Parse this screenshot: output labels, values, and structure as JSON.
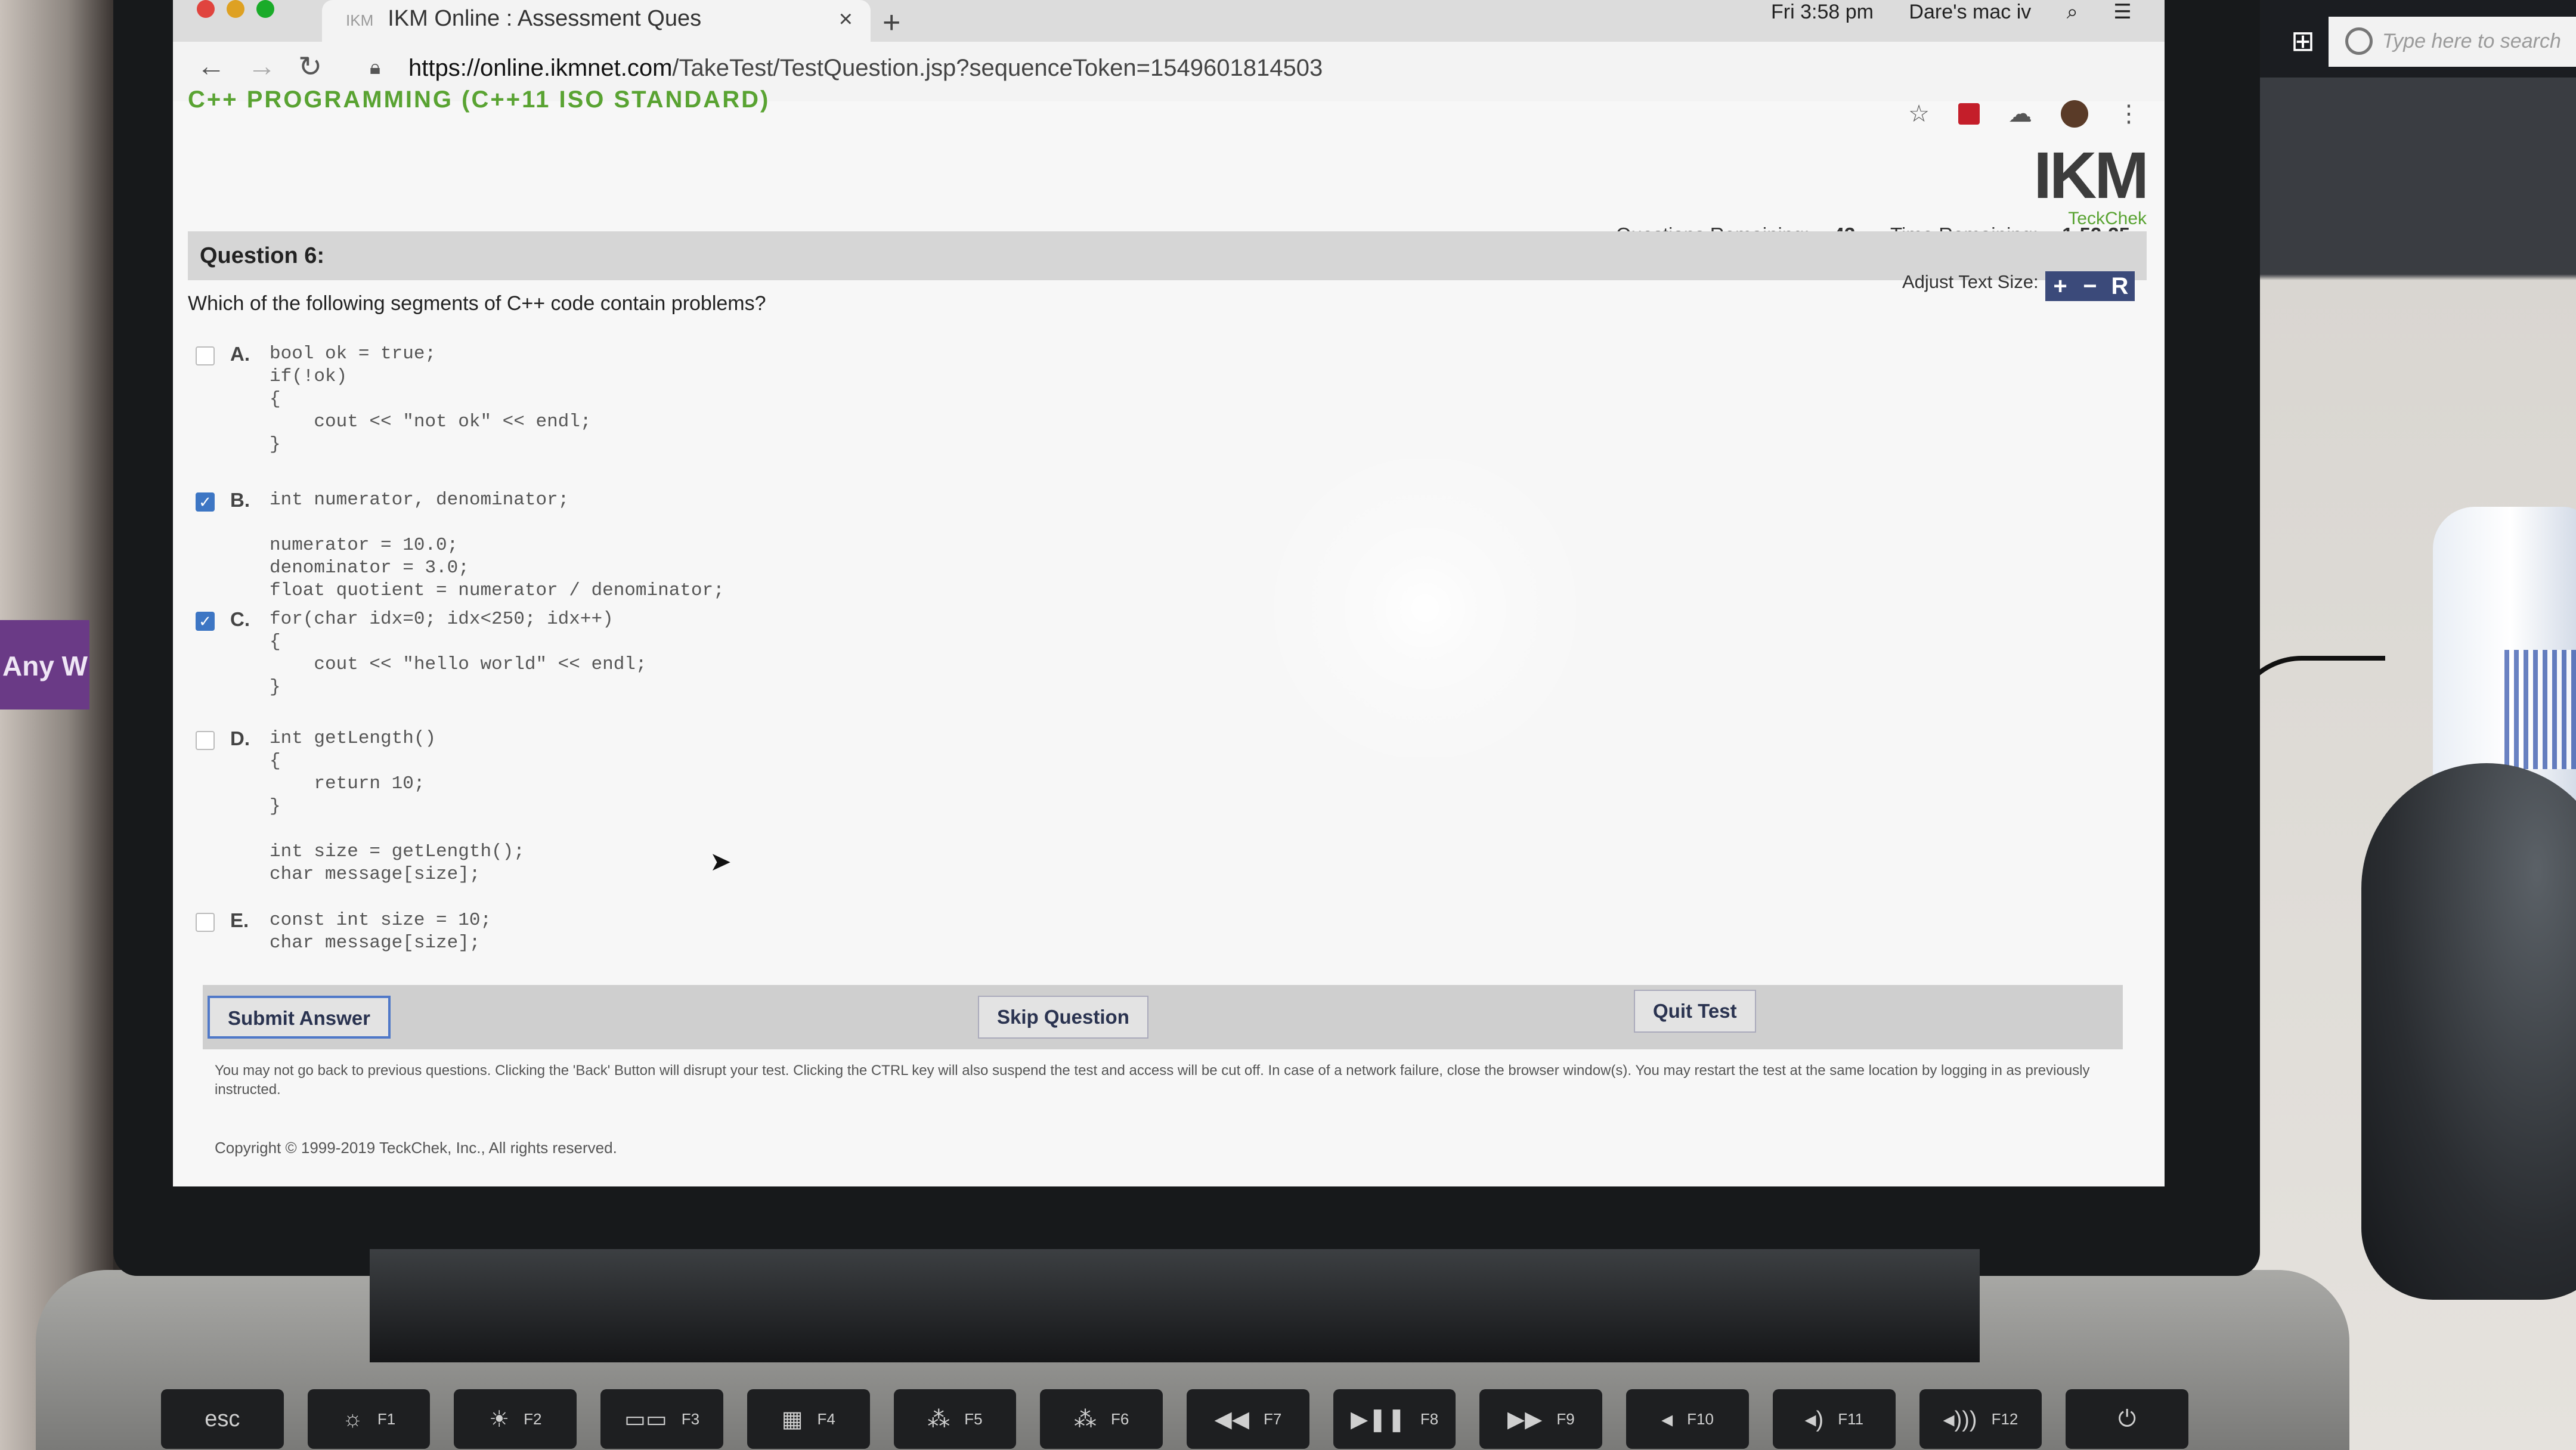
{
  "browser": {
    "tab_title": "IKM Online : Assessment Ques",
    "url_prefix": "https://online.ikmnet.com",
    "url_rest": "/TakeTest/TestQuestion.jsp?sequenceToken=1549601814503",
    "clock": "Fri 3:58 pm",
    "user": "Dare's mac iv"
  },
  "windows": {
    "search_placeholder": "Type here to search"
  },
  "desk": {
    "sticker_text": "Any W"
  },
  "page": {
    "course_title": "C++ PROGRAMMING (C++11 ISO STANDARD)",
    "logo_text": "IKM",
    "logo_subtitle": "TeckChek",
    "question_title": "Question 6:",
    "questions_remaining_label": "Questions Remaining:",
    "questions_remaining": "43",
    "time_remaining_label": "Time Remaining:",
    "time_remaining": "1:52:35",
    "adjust_text_label": "Adjust Text Size:",
    "adjust_plus": "+",
    "adjust_minus": "−",
    "adjust_reset": "R",
    "question_text": "Which of the following segments of C++ code contain problems?",
    "options": [
      {
        "letter": "A.",
        "checked": false,
        "code": "bool ok = true;\nif(!ok)\n{\n    cout << \"not ok\" << endl;\n}"
      },
      {
        "letter": "B.",
        "checked": true,
        "code": "int numerator, denominator;\n\nnumerator = 10.0;\ndenominator = 3.0;\nfloat quotient = numerator / denominator;"
      },
      {
        "letter": "C.",
        "checked": true,
        "code": "for(char idx=0; idx<250; idx++)\n{\n    cout << \"hello world\" << endl;\n}"
      },
      {
        "letter": "D.",
        "checked": false,
        "code": "int getLength()\n{\n    return 10;\n}\n\nint size = getLength();\nchar message[size];"
      },
      {
        "letter": "E.",
        "checked": false,
        "code": "const int size = 10;\nchar message[size];"
      }
    ],
    "submit_label": "Submit Answer",
    "skip_label": "Skip Question",
    "quit_label": "Quit Test",
    "notice": "You may not go back to previous questions. Clicking the 'Back' Button will disrupt your test. Clicking the CTRL key will also suspend the test and access will be cut off. In case of a network failure, close the browser window(s). You may restart the test at the same location by logging in as previously instructed.",
    "copyright": "Copyright © 1999-2019 TeckChek, Inc., All rights reserved."
  },
  "keyboard": {
    "keys": [
      "esc",
      "F1",
      "F2",
      "F3",
      "F4",
      "F5",
      "F6",
      "F7",
      "F8",
      "F9",
      "F10",
      "F11",
      "F12"
    ]
  },
  "colors": {
    "accent_green": "#59a332",
    "checkbox_blue": "#3d76c4",
    "adjust_button": "#3b4a7a"
  }
}
